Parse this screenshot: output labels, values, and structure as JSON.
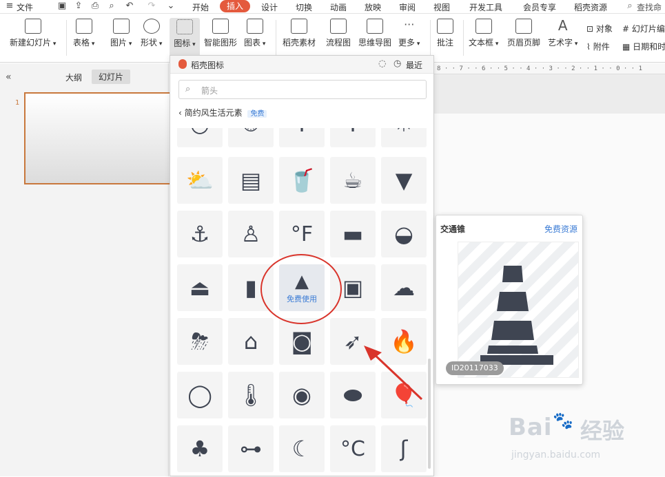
{
  "menubar": {
    "file": "文件",
    "tabs": [
      "开始",
      "插入",
      "设计",
      "切换",
      "动画",
      "放映",
      "审阅",
      "视图",
      "开发工具",
      "会员专享",
      "稻壳资源"
    ],
    "active_tab": "插入",
    "search": "查找命"
  },
  "toolbar": {
    "new_slide": "新建幻灯片",
    "table": "表格",
    "picture": "图片",
    "shape": "形状",
    "icon": "图标",
    "smart_graphic": "智能图形",
    "chart": "图表",
    "docer_material": "稻壳素材",
    "flowchart": "流程图",
    "mindmap": "思维导图",
    "more": "更多",
    "comment": "批注",
    "textbox": "文本框",
    "header_footer": "页眉页脚",
    "wordart": "艺术字",
    "object": "对象",
    "attachment": "附件",
    "slide_number": "幻灯片编",
    "date_time": "日期和时"
  },
  "leftpane": {
    "tab_outline": "大纲",
    "tab_slides": "幻灯片",
    "slide_number": "1"
  },
  "ruler": "8 · · 7 · · 6 · · 5 · · 4 · · 3 · · 2 · · 1 · · 0 · · 1",
  "panel": {
    "title": "稻壳图标",
    "recent": "最近",
    "search_placeholder": "箭头",
    "breadcrumb": "简约风生活元素",
    "free_badge": "免费",
    "free_use": "免费使用"
  },
  "preview": {
    "title": "交通锥",
    "free_resource": "免费资源",
    "id": "ID20117033"
  },
  "icons": [
    "clock",
    "timer",
    "goblet",
    "goblet",
    "sun",
    "sun-cloud",
    "bricks",
    "soda-cup",
    "coffee-cup",
    "takeaway-cup",
    "crane-hook",
    "tank-top",
    "fahrenheit",
    "toolbox",
    "handbag",
    "bag",
    "popsicle",
    "traffic-cone",
    "briefcase",
    "cloud-rain",
    "cloud-storm",
    "roof",
    "camera",
    "firework-rocket",
    "campfire",
    "diving-mask",
    "thermometer",
    "washing-machine",
    "burger",
    "balloon",
    "tree",
    "dumbbell",
    "moon",
    "celsius",
    "hook"
  ],
  "watermark": {
    "brand": "Bai",
    "brand2": "经验",
    "url": "jingyan.baidu.com"
  },
  "colors": {
    "accent": "#e45a3d",
    "icon": "#3f4552",
    "link": "#3a7bd5",
    "annotation": "#d9342b"
  }
}
